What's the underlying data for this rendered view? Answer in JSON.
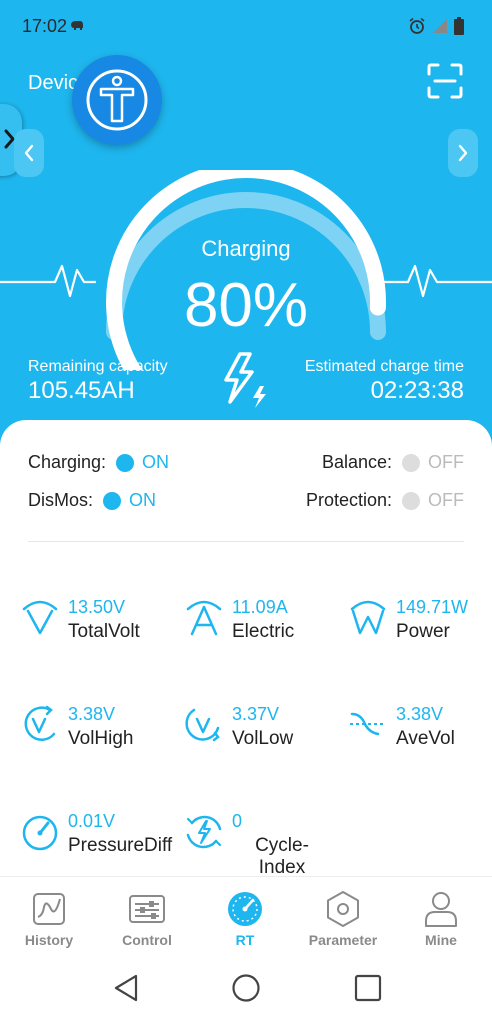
{
  "status_bar": {
    "time": "17:02",
    "icons": [
      "elephant-icon",
      "alarm-icon",
      "signal-icon",
      "battery-icon"
    ]
  },
  "header": {
    "device_label": "Device",
    "logo_icon": "t-person-logo",
    "scan_icon": "scan-icon"
  },
  "gauge": {
    "status": "Charging",
    "percent_text": "80%",
    "percent_value": 80,
    "remaining_label": "Remaining capacity",
    "remaining_value": "105.45AH",
    "estimate_label": "Estimated charge time",
    "estimate_value": "02:23:38"
  },
  "flags": {
    "charging": {
      "label": "Charging:",
      "state": "ON"
    },
    "balance": {
      "label": "Balance:",
      "state": "OFF"
    },
    "dismos": {
      "label": "DisMos:",
      "state": "ON"
    },
    "protection": {
      "label": "Protection:",
      "state": "OFF"
    }
  },
  "metrics": [
    {
      "value": "13.50V",
      "label": "TotalVolt",
      "icon": "total-volt-icon"
    },
    {
      "value": "11.09A",
      "label": "Electric",
      "icon": "current-icon"
    },
    {
      "value": "149.71W",
      "label": "Power",
      "icon": "power-icon"
    },
    {
      "value": "3.38V",
      "label": "VolHigh",
      "icon": "vol-high-icon"
    },
    {
      "value": "3.37V",
      "label": "VolLow",
      "icon": "vol-low-icon"
    },
    {
      "value": "3.38V",
      "label": "AveVol",
      "icon": "ave-vol-icon"
    },
    {
      "value": "0.01V",
      "label": "PressureDiff",
      "icon": "gauge-icon"
    },
    {
      "value": "0",
      "label": "Cycle-Index",
      "icon": "cycle-icon"
    }
  ],
  "tabs": [
    {
      "label": "History",
      "icon": "history-icon"
    },
    {
      "label": "Control",
      "icon": "control-icon"
    },
    {
      "label": "RT",
      "icon": "rt-gauge-icon",
      "active": true
    },
    {
      "label": "Parameter",
      "icon": "parameter-hexagon-icon"
    },
    {
      "label": "Mine",
      "icon": "person-icon"
    }
  ],
  "colors": {
    "primary": "#1EB6EE",
    "logo": "#1788E3",
    "off_gray": "#DDDDDD"
  }
}
